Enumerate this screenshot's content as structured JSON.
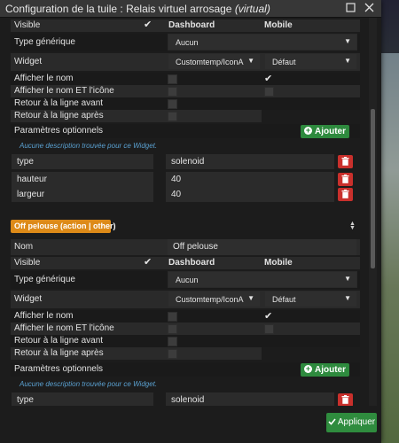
{
  "window": {
    "title_prefix": "Configuration de la tuile : Relais virtuel arrosage ",
    "title_suffix": "(virtual)",
    "maximize_icon": "maximize-icon",
    "close_icon": "close-icon"
  },
  "section1": {
    "visible_label": "Visible",
    "dashboard_header": "Dashboard",
    "mobile_header": "Mobile",
    "type_label": "Type générique",
    "type_value": "Aucun",
    "widget_label": "Widget",
    "widget_dashboard": "Customtemp/IconA",
    "widget_mobile": "Défaut",
    "afficher_nom": "Afficher le nom",
    "afficher_nom_icone": "Afficher le nom ET l'icône",
    "retour_avant": "Retour à la ligne avant",
    "retour_apres": "Retour à la ligne après",
    "params_label": "Paramètres optionnels",
    "ajouter_label": "Ajouter",
    "desc": "Aucune description trouvée pour ce Widget.",
    "params": [
      {
        "key": "type",
        "value": "solenoid"
      },
      {
        "key": "hauteur",
        "value": "40"
      },
      {
        "key": "largeur",
        "value": "40"
      }
    ]
  },
  "section2": {
    "badge": "Off pelouse (action | other)",
    "nom_label": "Nom",
    "nom_value": "Off pelouse",
    "visible_label": "Visible",
    "dashboard_header": "Dashboard",
    "mobile_header": "Mobile",
    "type_label": "Type générique",
    "type_value": "Aucun",
    "widget_label": "Widget",
    "widget_dashboard": "Customtemp/IconA",
    "widget_mobile": "Défaut",
    "afficher_nom": "Afficher le nom",
    "afficher_nom_icone": "Afficher le nom ET l'icône",
    "retour_avant": "Retour à la ligne avant",
    "retour_apres": "Retour à la ligne après",
    "params_label": "Paramètres optionnels",
    "ajouter_label": "Ajouter",
    "desc": "Aucune description trouvée pour ce Widget.",
    "params": [
      {
        "key": "type",
        "value": "solenoid"
      }
    ]
  },
  "footer": {
    "apply_label": "Appliquer"
  },
  "colors": {
    "accent_green": "#2e8a3e",
    "delete_red": "#c9302c",
    "badge_orange": "#dd8a18",
    "desc_blue": "#5aa0d0"
  }
}
